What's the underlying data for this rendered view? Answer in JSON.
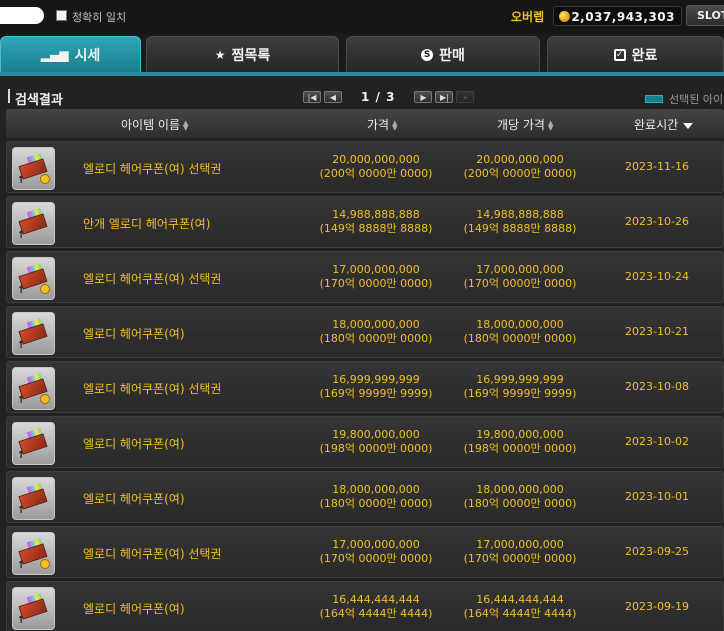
{
  "topbar": {
    "exact_match_label": "정확히 일치",
    "brand": "오버렙",
    "meso": "2,037,943,303",
    "slot_label": "SLOT"
  },
  "tabs": [
    {
      "label": "시세",
      "icon": "bar-chart-icon",
      "active": true
    },
    {
      "label": "찜목록",
      "icon": "star-icon",
      "active": false
    },
    {
      "label": "판매",
      "icon": "s-coin-icon",
      "active": false
    },
    {
      "label": "완료",
      "icon": "check-box-icon",
      "active": false
    }
  ],
  "results": {
    "title": "검색결과",
    "page": "1 / 3",
    "legend_label": "선택된 아이"
  },
  "columns": {
    "name": "아이템 이름",
    "price": "가격",
    "unit_price": "개당 가격",
    "completed": "완료시간"
  },
  "colors": {
    "accent": "#1a7d8c",
    "gold_text": "#f0c020"
  },
  "rows": [
    {
      "name": "엘로디 헤어쿠폰(여) 선택권",
      "price": "20,000,000,000",
      "price_kr": "(200억 0000만 0000)",
      "unit": "20,000,000,000",
      "unit_kr": "(200억 0000만 0000)",
      "date": "2023-11-16",
      "badge": true
    },
    {
      "name": "안개 엘로디 헤어쿠폰(여)",
      "price": "14,988,888,888",
      "price_kr": "(149억 8888만 8888)",
      "unit": "14,988,888,888",
      "unit_kr": "(149억 8888만 8888)",
      "date": "2023-10-26",
      "badge": false
    },
    {
      "name": "엘로디 헤어쿠폰(여) 선택권",
      "price": "17,000,000,000",
      "price_kr": "(170억 0000만 0000)",
      "unit": "17,000,000,000",
      "unit_kr": "(170억 0000만 0000)",
      "date": "2023-10-24",
      "badge": true
    },
    {
      "name": "엘로디 헤어쿠폰(여)",
      "price": "18,000,000,000",
      "price_kr": "(180억 0000만 0000)",
      "unit": "18,000,000,000",
      "unit_kr": "(180억 0000만 0000)",
      "date": "2023-10-21",
      "badge": false
    },
    {
      "name": "엘로디 헤어쿠폰(여) 선택권",
      "price": "16,999,999,999",
      "price_kr": "(169억 9999만 9999)",
      "unit": "16,999,999,999",
      "unit_kr": "(169억 9999만 9999)",
      "date": "2023-10-08",
      "badge": true
    },
    {
      "name": "엘로디 헤어쿠폰(여)",
      "price": "19,800,000,000",
      "price_kr": "(198억 0000만 0000)",
      "unit": "19,800,000,000",
      "unit_kr": "(198억 0000만 0000)",
      "date": "2023-10-02",
      "badge": false
    },
    {
      "name": "엘로디 헤어쿠폰(여)",
      "price": "18,000,000,000",
      "price_kr": "(180억 0000만 0000)",
      "unit": "18,000,000,000",
      "unit_kr": "(180억 0000만 0000)",
      "date": "2023-10-01",
      "badge": false
    },
    {
      "name": "엘로디 헤어쿠폰(여) 선택권",
      "price": "17,000,000,000",
      "price_kr": "(170억 0000만 0000)",
      "unit": "17,000,000,000",
      "unit_kr": "(170억 0000만 0000)",
      "date": "2023-09-25",
      "badge": true
    },
    {
      "name": "엘로디 헤어쿠폰(여)",
      "price": "16,444,444,444",
      "price_kr": "(164억 4444만 4444)",
      "unit": "16,444,444,444",
      "unit_kr": "(164억 4444만 4444)",
      "date": "2023-09-19",
      "badge": false
    }
  ]
}
